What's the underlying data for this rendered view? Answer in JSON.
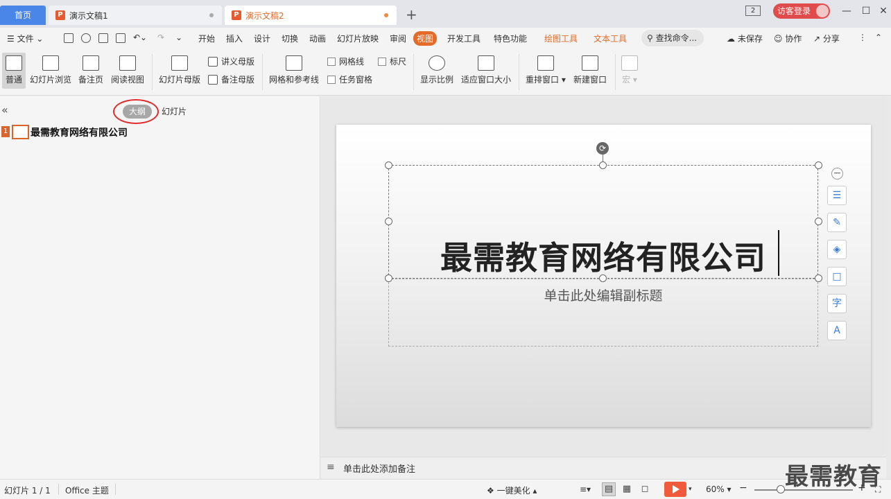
{
  "titlebar": {
    "home_tab": "首页",
    "doc_tabs": [
      {
        "label": "演示文稿1",
        "active": false
      },
      {
        "label": "演示文稿2",
        "active": true
      }
    ],
    "plus": "+",
    "window_count": "2",
    "visitor_login": "访客登录"
  },
  "menubar": {
    "file": "文件",
    "items": [
      "开始",
      "插入",
      "设计",
      "切换",
      "动画",
      "幻灯片放映",
      "审阅",
      "视图",
      "开发工具",
      "特色功能",
      "绘图工具",
      "文本工具"
    ],
    "active_item": "视图",
    "search_placeholder": "查找命令...",
    "unsaved": "未保存",
    "collaborate": "协作",
    "share": "分享"
  },
  "ribbon": {
    "normal": "普通",
    "slide_sorter": "幻灯片浏览",
    "notes_page": "备注页",
    "reading_view": "阅读视图",
    "slide_master": "幻灯片母版",
    "handout_master": "讲义母版",
    "notes_master": "备注母版",
    "grid_guides": "网格和参考线",
    "gridlines": "网格线",
    "ruler": "标尺",
    "task_pane": "任务窗格",
    "zoom": "显示比例",
    "fit_window": "适应窗口大小",
    "arrange": "重排窗口",
    "new_window": "新建窗口",
    "macro": "宏"
  },
  "leftpanel": {
    "outline_tab": "大纲",
    "slides_tab": "幻灯片",
    "slide_number": "1",
    "outline_text": "最需教育网络有限公司"
  },
  "slide": {
    "title": "最需教育网络有限公司",
    "subtitle_placeholder": "单击此处编辑副标题"
  },
  "notes": {
    "placeholder": "单击此处添加备注"
  },
  "statusbar": {
    "slide_counter": "幻灯片 1 / 1",
    "theme": "Office 主题",
    "beautify": "一键美化",
    "zoom": "60%"
  },
  "watermark": "最需教育"
}
